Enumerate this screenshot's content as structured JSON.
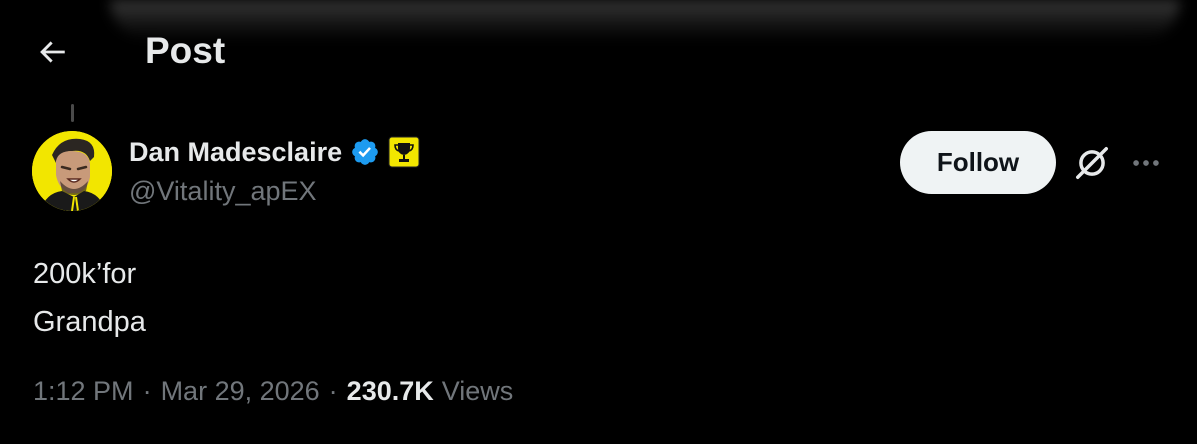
{
  "header": {
    "title": "Post",
    "back_icon": "arrow-left-icon"
  },
  "author": {
    "display_name": "Dan Madesclaire",
    "handle": "@Vitality_apEX",
    "verified_icon": "verified-badge-icon",
    "affiliate_icon": "trophy-badge-icon",
    "avatar_bg": "#f2e600"
  },
  "actions": {
    "follow_label": "Follow",
    "grok_icon": "grok-icon",
    "more_icon": "more-horizontal-icon"
  },
  "post": {
    "line1": "200k’for",
    "line2": "Grandpa"
  },
  "meta": {
    "time": "1:12 PM",
    "separator": "·",
    "date": "Mar 29, 2026",
    "views_count": "230.7K",
    "views_label": "Views"
  },
  "colors": {
    "background": "#000000",
    "text_primary": "#e7e9ea",
    "text_secondary": "#71767b",
    "verified_blue": "#1d9bf0",
    "badge_yellow": "#f2e600",
    "follow_bg": "#eff3f4"
  }
}
